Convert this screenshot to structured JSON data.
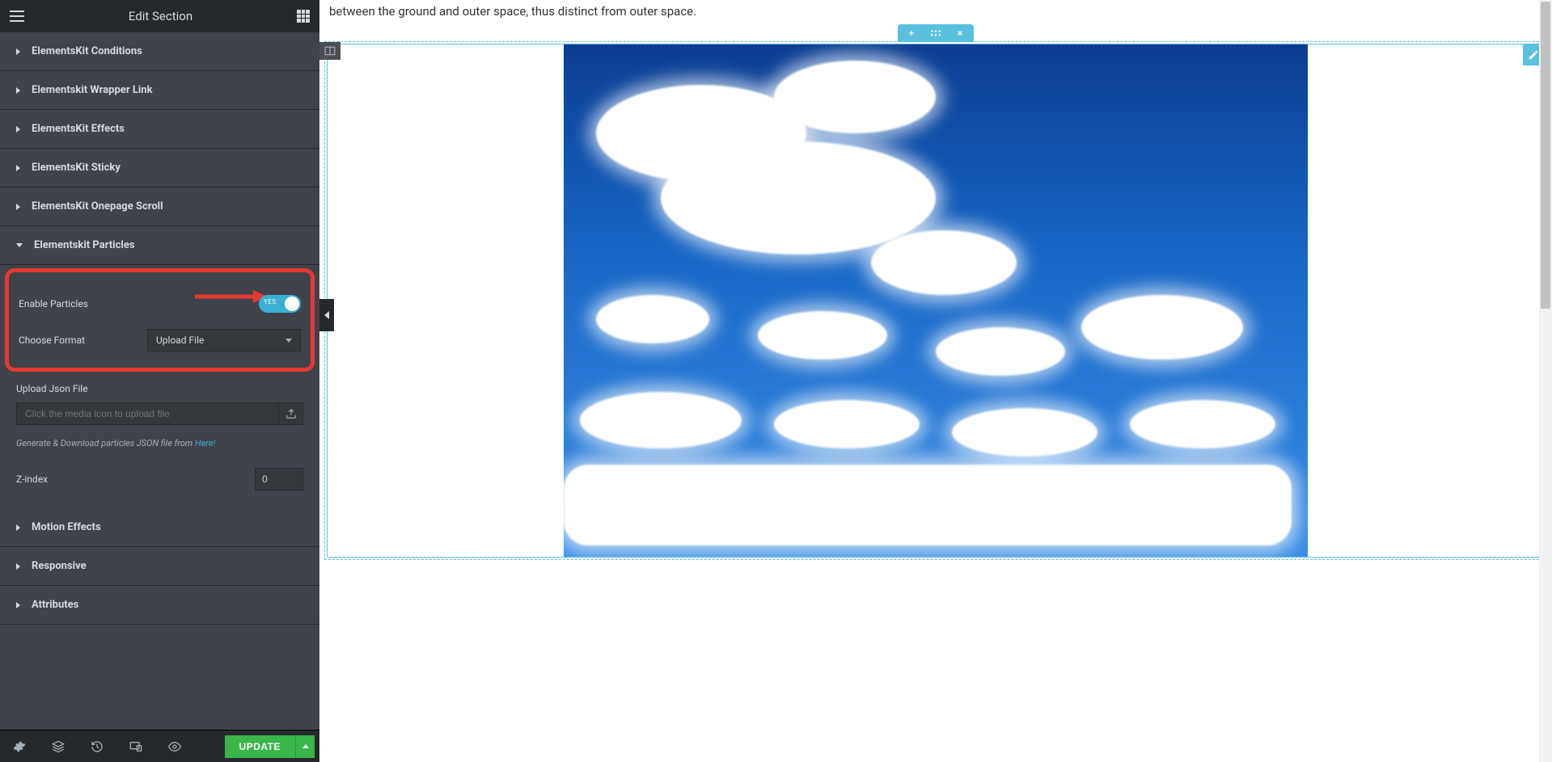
{
  "sidebar": {
    "title": "Edit Section",
    "sections": {
      "conditions": "ElementsKit Conditions",
      "wrapper_link": "Elementskit Wrapper Link",
      "effects": "ElementsKit Effects",
      "sticky": "ElementsKit Sticky",
      "onepage": "ElementsKit Onepage Scroll",
      "particles": "Elementskit Particles",
      "motion": "Motion Effects",
      "responsive": "Responsive",
      "attributes": "Attributes"
    },
    "particles_panel": {
      "enable_label": "Enable Particles",
      "toggle_state": "YES",
      "format_label": "Choose Format",
      "format_value": "Upload File",
      "upload_label": "Upload Json File",
      "upload_placeholder": "Click the media icon to upload file",
      "hint_prefix": "Generate & Download particles JSON file from ",
      "hint_link": "Here!",
      "zindex_label": "Z-index",
      "zindex_value": "0"
    },
    "footer": {
      "update": "UPDATE"
    }
  },
  "canvas": {
    "page_text": "between the ground and outer space, thus distinct from outer space."
  },
  "colors": {
    "accent": "#5bc0de",
    "success": "#39b54a",
    "highlight": "#e53935"
  }
}
